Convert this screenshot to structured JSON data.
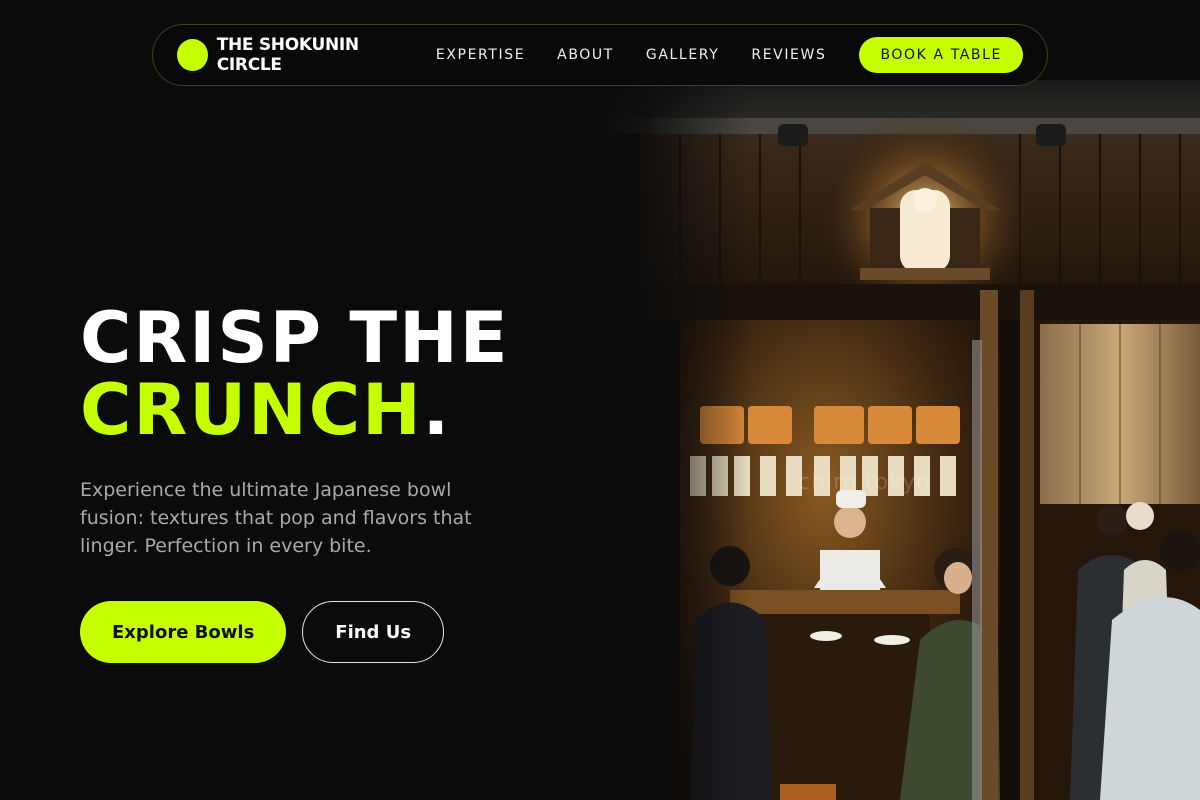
{
  "nav": {
    "brand": "THE SHOKUNIN CIRCLE",
    "links": [
      {
        "label": "EXPERTISE"
      },
      {
        "label": "ABOUT"
      },
      {
        "label": "GALLERY"
      },
      {
        "label": "REVIEWS"
      }
    ],
    "cta_label": "BOOK A TABLE"
  },
  "hero": {
    "title_line1": "CRISP THE",
    "title_accent": "CRUNCH",
    "title_period": ".",
    "subtitle": "Experience the ultimate Japanese bowl fusion: textures that pop and flavors that linger. Perfection in every bite.",
    "primary_button": "Explore Bowls",
    "secondary_button": "Find Us"
  },
  "photo": {
    "subject": "izakaya-interior-photo",
    "watermark": "chiro tokyo"
  },
  "colors": {
    "accent": "#c6ff00",
    "background": "#0b0b0b",
    "text": "#ffffff",
    "muted_text": "#a9a9a9"
  }
}
